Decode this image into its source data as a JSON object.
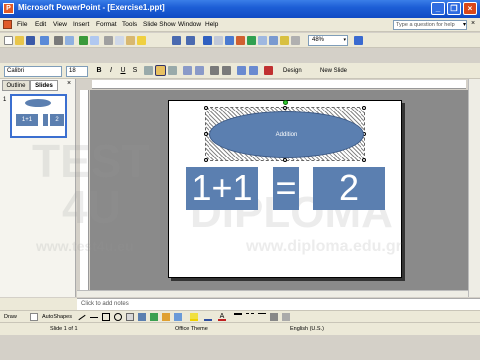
{
  "window": {
    "title": "Microsoft PowerPoint - [Exercise1.ppt]",
    "app_icon_glyph": "P"
  },
  "menu": {
    "items": [
      "File",
      "Edit",
      "View",
      "Insert",
      "Format",
      "Tools",
      "Slide Show",
      "Window",
      "Help"
    ],
    "help_placeholder": "Type a question for help",
    "doc_close": "×"
  },
  "toolbar": {
    "zoom": "48%"
  },
  "formatting": {
    "font": "Calibri",
    "size": "18",
    "bold": "B",
    "italic": "I",
    "underline": "U",
    "shadow": "S",
    "design_label": "Design",
    "new_slide_label": "New Slide"
  },
  "pane": {
    "tabs": [
      "Outline",
      "Slides"
    ],
    "close": "×",
    "thumb_number": "1",
    "thumb_box1": "1+1",
    "thumb_box2": "2"
  },
  "slide": {
    "ellipse_text": "Addition",
    "box1": "1+1",
    "equals": "=",
    "box2": "2"
  },
  "notes": {
    "placeholder": "Click to add notes"
  },
  "drawing": {
    "draw_label": "Draw",
    "autoshapes_label": "AutoShapes"
  },
  "status": {
    "slide_info": "Slide 1 of 1",
    "design": "Office Theme",
    "language": "English (U.S.)"
  },
  "watermark": {
    "line1": "TEST",
    "line2": "4U",
    "line3": "DIPLOMA",
    "url1": "www.test4u.eu",
    "url2": "www.diploma.edu.gr"
  }
}
